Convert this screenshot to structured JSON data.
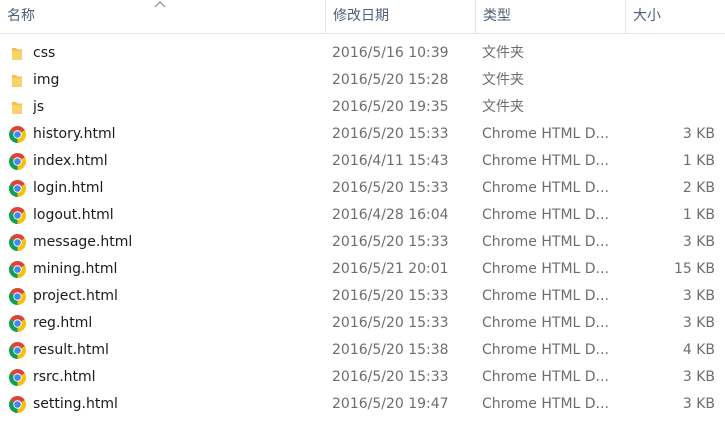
{
  "header": {
    "name": "名称",
    "date": "修改日期",
    "type": "类型",
    "size": "大小"
  },
  "colors": {
    "folder": "#f4c04a",
    "chrome_red": "#db4437",
    "chrome_yellow": "#f4c20d",
    "chrome_green": "#0f9d58",
    "chrome_blue": "#4285f4",
    "header_text": "#4c607a"
  },
  "files": [
    {
      "icon": "folder-icon",
      "name": "css",
      "date": "2016/5/16 10:39",
      "type": "文件夹",
      "size": ""
    },
    {
      "icon": "folder-icon",
      "name": "img",
      "date": "2016/5/20 15:28",
      "type": "文件夹",
      "size": ""
    },
    {
      "icon": "folder-icon",
      "name": "js",
      "date": "2016/5/20 19:35",
      "type": "文件夹",
      "size": ""
    },
    {
      "icon": "chrome-icon",
      "name": "history.html",
      "date": "2016/5/20 15:33",
      "type": "Chrome HTML D...",
      "size": "3 KB"
    },
    {
      "icon": "chrome-icon",
      "name": "index.html",
      "date": "2016/4/11 15:43",
      "type": "Chrome HTML D...",
      "size": "1 KB"
    },
    {
      "icon": "chrome-icon",
      "name": "login.html",
      "date": "2016/5/20 15:33",
      "type": "Chrome HTML D...",
      "size": "2 KB"
    },
    {
      "icon": "chrome-icon",
      "name": "logout.html",
      "date": "2016/4/28 16:04",
      "type": "Chrome HTML D...",
      "size": "1 KB"
    },
    {
      "icon": "chrome-icon",
      "name": "message.html",
      "date": "2016/5/20 15:33",
      "type": "Chrome HTML D...",
      "size": "3 KB"
    },
    {
      "icon": "chrome-icon",
      "name": "mining.html",
      "date": "2016/5/21 20:01",
      "type": "Chrome HTML D...",
      "size": "15 KB"
    },
    {
      "icon": "chrome-icon",
      "name": "project.html",
      "date": "2016/5/20 15:33",
      "type": "Chrome HTML D...",
      "size": "3 KB"
    },
    {
      "icon": "chrome-icon",
      "name": "reg.html",
      "date": "2016/5/20 15:33",
      "type": "Chrome HTML D...",
      "size": "3 KB"
    },
    {
      "icon": "chrome-icon",
      "name": "result.html",
      "date": "2016/5/20 15:38",
      "type": "Chrome HTML D...",
      "size": "4 KB"
    },
    {
      "icon": "chrome-icon",
      "name": "rsrc.html",
      "date": "2016/5/20 15:33",
      "type": "Chrome HTML D...",
      "size": "3 KB"
    },
    {
      "icon": "chrome-icon",
      "name": "setting.html",
      "date": "2016/5/20 19:47",
      "type": "Chrome HTML D...",
      "size": "3 KB"
    }
  ]
}
